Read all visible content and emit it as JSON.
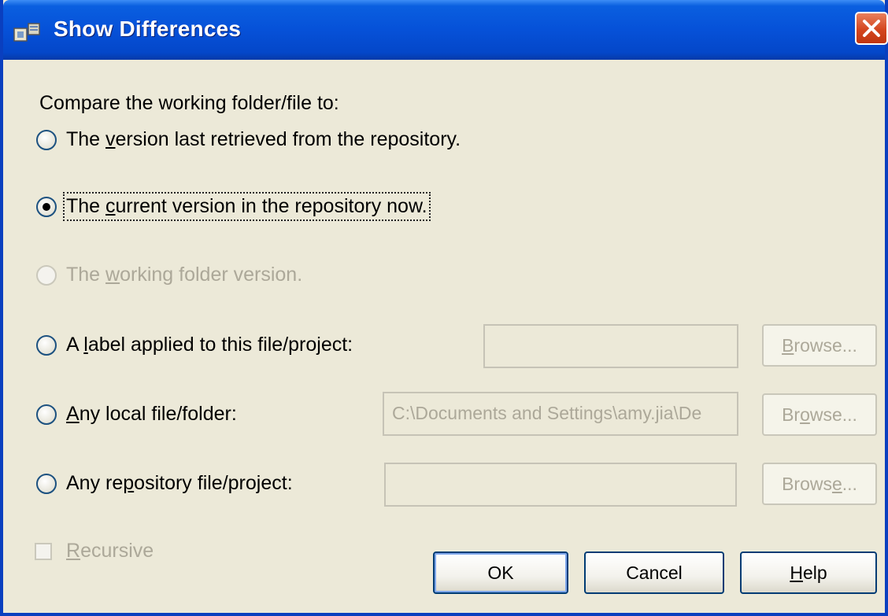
{
  "dialog": {
    "title": "Show Differences",
    "close_icon": "close-icon",
    "accent": "#0651d8"
  },
  "prompt": "Compare the working folder/file to:",
  "options": [
    {
      "label_pre": "The ",
      "mnemonic": "v",
      "label_post": "ersion last retrieved from the repository.",
      "checked": false,
      "enabled": true
    },
    {
      "label_pre": "The ",
      "mnemonic": "c",
      "label_post": "urrent version in the repository now.",
      "checked": true,
      "enabled": true
    },
    {
      "label_pre": "The ",
      "mnemonic": "w",
      "label_post": "orking folder version.",
      "checked": false,
      "enabled": false
    },
    {
      "label_pre": "A ",
      "mnemonic": "l",
      "label_post": "abel applied to this file/project:",
      "checked": false,
      "enabled": true
    },
    {
      "label_pre": "",
      "mnemonic": "A",
      "label_post": "ny local file/folder:",
      "checked": false,
      "enabled": true
    },
    {
      "label_pre": "Any re",
      "mnemonic": "p",
      "label_post": "ository file/project:",
      "checked": false,
      "enabled": true
    }
  ],
  "fields": {
    "label_value": "",
    "local_value": "C:\\Documents and Settings\\amy.jia\\De",
    "repository_value": ""
  },
  "browse_buttons": [
    {
      "pre": "",
      "mnemonic": "B",
      "post": "rowse..."
    },
    {
      "pre": "Br",
      "mnemonic": "o",
      "post": "wse..."
    },
    {
      "pre": "Brows",
      "mnemonic": "e",
      "post": "..."
    }
  ],
  "recursive": {
    "mnemonic": "R",
    "rest": "ecursive",
    "checked": false,
    "enabled": false
  },
  "buttons": {
    "ok": "OK",
    "cancel": "Cancel",
    "help_mnemonic": "H",
    "help_rest": "elp"
  }
}
